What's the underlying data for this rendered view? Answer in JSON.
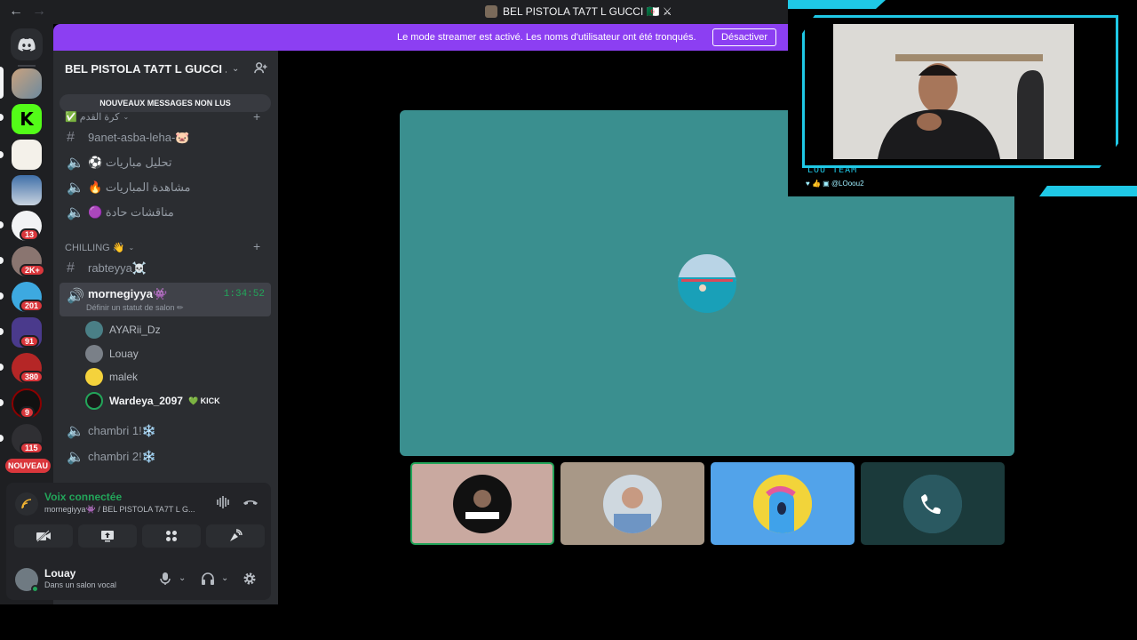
{
  "window": {
    "title": "BEL PISTOLA TA7T L GUCCI 🇩🇿 ⚔"
  },
  "banner": {
    "text": "Le mode streamer est activé. Les noms d'utilisateur ont été tronqués.",
    "button": "Désactiver"
  },
  "rail": {
    "badges": [
      "13",
      "2K+",
      "201",
      "91",
      "380",
      "9",
      "115"
    ],
    "new_label": "NOUVEAU"
  },
  "guild": {
    "name": "BEL PISTOLA TA7T L GUCCI ..."
  },
  "unread_label": "NOUVEAUX MESSAGES NON LUS",
  "categories": {
    "kora": "✅ كرة القدم",
    "chilling": "CHILLING 👋"
  },
  "channels": {
    "c1": "9anet-asba-leha-🐷",
    "c2": "⚽ تحليل مباريات",
    "c3": "🔥 مشاهدة المباريات",
    "c4": "🟣 مناقشات حادة",
    "c5": "rabteyya☠️",
    "c6": "mornegiyya👾",
    "c6_timer": "1:34:52",
    "c6_status": "Définir un statut de salon ✏",
    "c7": "chambri 1!❄️",
    "c8": "chambri 2!❄️"
  },
  "members": [
    "AYARii_Dz",
    "Louay",
    "malek",
    "Wardeya_2097"
  ],
  "kick_label": "💚 KICK",
  "voice": {
    "title": "Voix connectée",
    "sub": "mornegiyya👾 / BEL PISTOLA TA7T L G..."
  },
  "user": {
    "name": "Louay",
    "status": "Dans un salon vocal"
  },
  "overlay": {
    "label": "LOU TEAM",
    "handle": "♥ 👍 ▣ @LOoou2"
  },
  "colors": {
    "accent": "#8c3ff2",
    "online": "#23a55a",
    "cyan": "#1fc8e6",
    "stage": "#3a8f8f"
  }
}
